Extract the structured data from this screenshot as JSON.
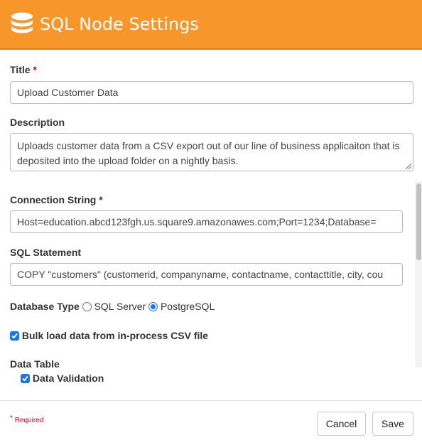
{
  "header": {
    "title": "SQL Node Settings",
    "icon": "database-icon",
    "background_color": "#f7962a"
  },
  "fields": {
    "title": {
      "label": "Title",
      "required_mark": "*",
      "value": "Upload Customer Data"
    },
    "description": {
      "label": "Description",
      "value": "Uploads customer data from a CSV export out of our line of business applicaiton that is deposited into the upload folder on a nightly basis."
    },
    "connection_string": {
      "label": "Connection String *",
      "value": "Host=education.abcd123fgh.us.square9.amazonawes.com;Port=1234;Database="
    },
    "sql_statement": {
      "label": "SQL Statement",
      "value": "COPY \"customers\" (customerid, companyname, contactname, contacttitle, city, cou"
    },
    "database_type": {
      "label": "Database Type",
      "options": [
        "SQL Server",
        "PostgreSQL"
      ],
      "selected": "PostgreSQL"
    },
    "bulk_load": {
      "label": "Bulk load data from in-process CSV file",
      "checked": true
    },
    "data_table": {
      "label": "Data Table"
    },
    "data_validation": {
      "label": "Data Validation",
      "checked": true
    }
  },
  "footer": {
    "required_mark": "*",
    "required_note": "Required",
    "cancel_label": "Cancel",
    "save_label": "Save"
  },
  "colors": {
    "accent": "#1a73e8",
    "required": "#d0021b"
  }
}
